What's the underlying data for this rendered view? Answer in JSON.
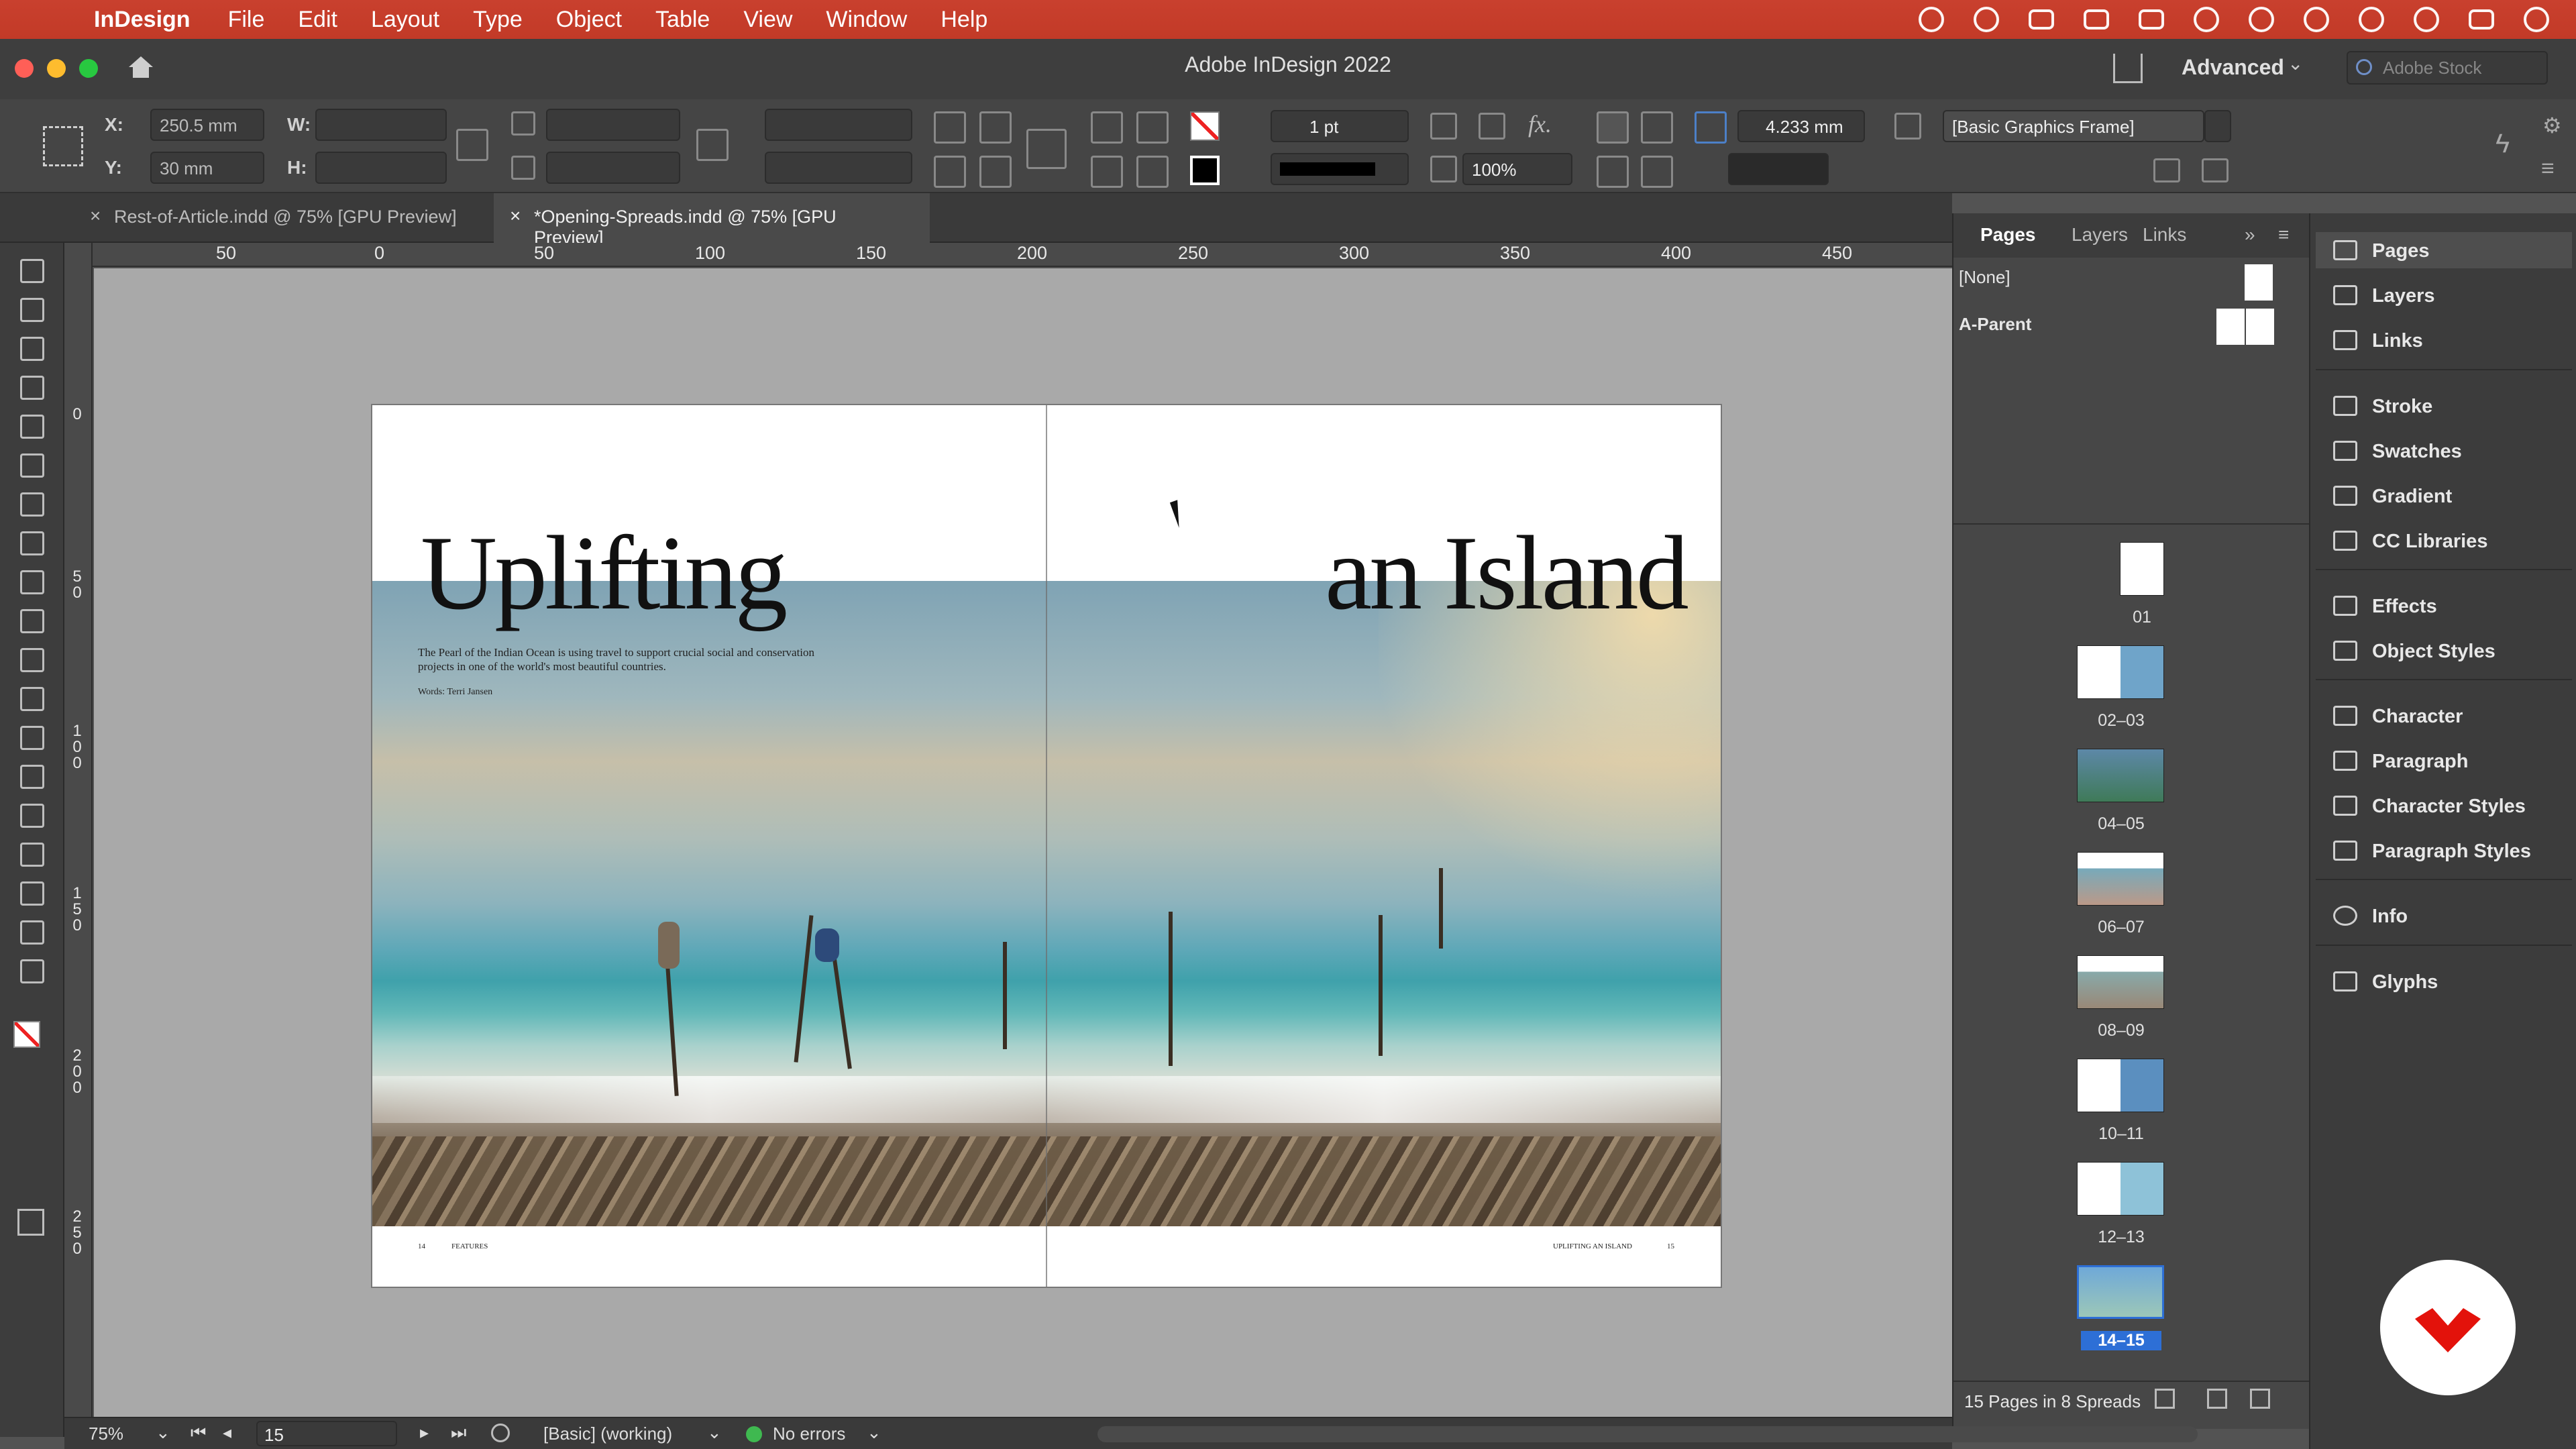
{
  "menubar": {
    "app": "InDesign",
    "items": [
      "File",
      "Edit",
      "Layout",
      "Type",
      "Object",
      "Table",
      "View",
      "Window",
      "Help"
    ]
  },
  "titlebar": {
    "title": "Adobe InDesign 2022",
    "workspace": "Advanced",
    "search_placeholder": "Adobe Stock"
  },
  "control": {
    "x_label": "X:",
    "x_value": "250.5 mm",
    "y_label": "Y:",
    "y_value": "30 mm",
    "w_label": "W:",
    "h_label": "H:",
    "stroke_weight": "1 pt",
    "opacity": "100%",
    "offset": "4.233 mm",
    "object_style": "[Basic Graphics Frame]"
  },
  "tabs": [
    {
      "label": "Rest-of-Article.indd @ 75% [GPU Preview]",
      "active": false
    },
    {
      "label": "*Opening-Spreads.indd @ 75% [GPU Preview]",
      "active": true
    }
  ],
  "ruler": {
    "h": [
      "50",
      "0",
      "50",
      "100",
      "150",
      "200",
      "250",
      "300",
      "350",
      "400",
      "450"
    ],
    "v": [
      "0",
      "5\n0",
      "1\n0\n0",
      "1\n5\n0",
      "2\n0\n0",
      "2\n5\n0"
    ]
  },
  "spread": {
    "headline_left": "Uplifting",
    "headline_right": "an Island",
    "standfirst": "The Pearl of the Indian Ocean is using travel to support crucial social and conservation projects in one of the world's most beautiful countries.",
    "byline": "Words: Terri Jansen",
    "folio_left_num": "14",
    "folio_left": "FEATURES",
    "folio_right": "UPLIFTING AN ISLAND",
    "folio_right_num": "15"
  },
  "pages_panel": {
    "tabs": [
      "Pages",
      "Layers",
      "Links"
    ],
    "parents": [
      "[None]",
      "A-Parent"
    ],
    "spreads": [
      "01",
      "02–03",
      "04–05",
      "06–07",
      "08–09",
      "10–11",
      "12–13",
      "14–15"
    ],
    "footer": "15 Pages in 8 Spreads"
  },
  "dock": {
    "groups": [
      [
        "Pages",
        "Layers",
        "Links"
      ],
      [
        "Stroke",
        "Swatches",
        "Gradient",
        "CC Libraries"
      ],
      [
        "Effects",
        "Object Styles"
      ],
      [
        "Character",
        "Paragraph",
        "Character Styles",
        "Paragraph Styles"
      ],
      [
        "Info"
      ],
      [
        "Glyphs"
      ]
    ]
  },
  "status": {
    "zoom": "75%",
    "page": "15",
    "preflight_profile": "[Basic] (working)",
    "errors": "No errors"
  },
  "colors": {
    "menubar": "#c23a27",
    "accent": "#2d6fd6",
    "ok": "#3fb950"
  }
}
